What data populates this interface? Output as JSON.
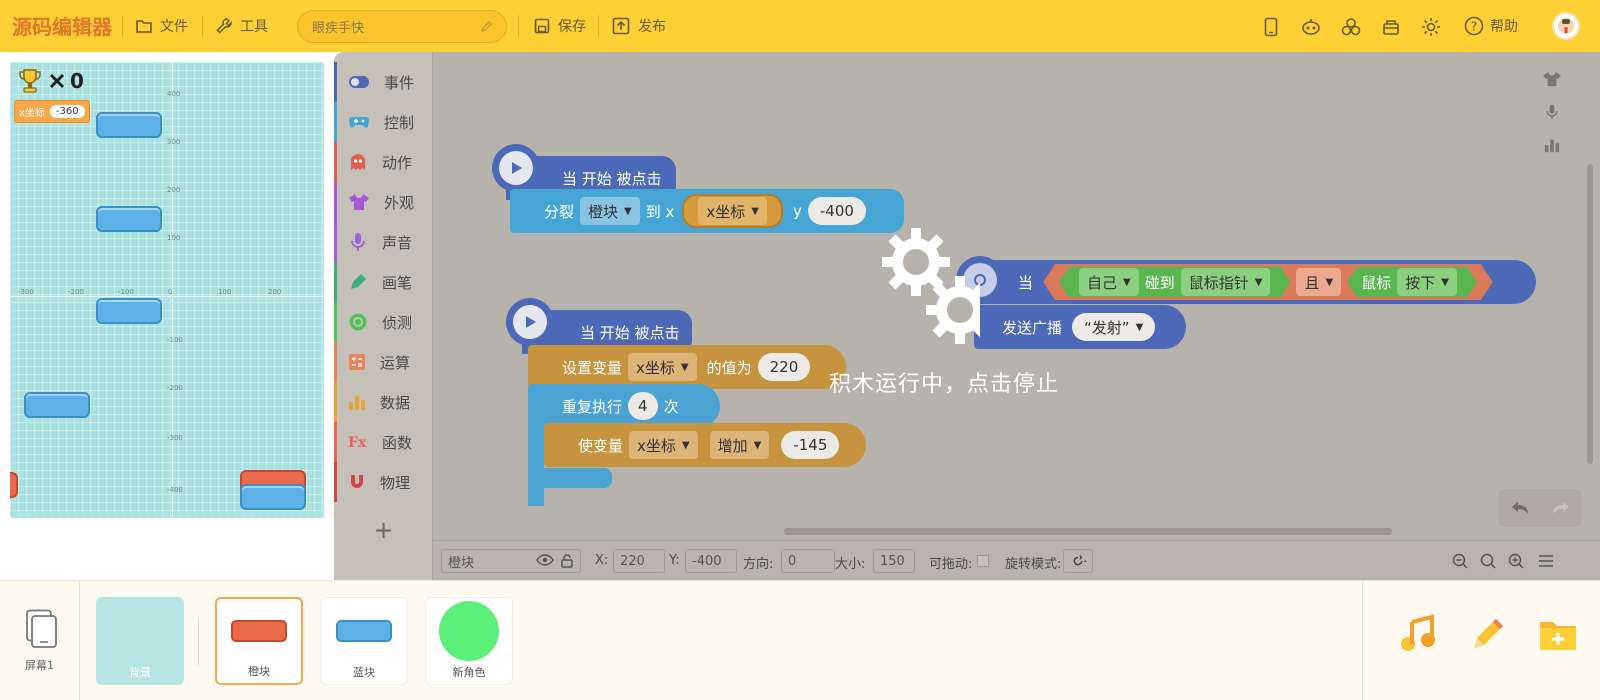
{
  "topbar": {
    "logo": "源码编辑器",
    "file": "文件",
    "tools": "工具",
    "project_name": "眼疾手快",
    "save": "保存",
    "publish": "发布",
    "help": "帮助",
    "bg_color": "#fdd035"
  },
  "stage": {
    "score": "0",
    "var_label": "x坐标",
    "var_value": "-360",
    "ticks_x": [
      "-300",
      "-200",
      "-100",
      "0",
      "100",
      "200"
    ],
    "ticks_y": [
      "400",
      "300",
      "200",
      "100",
      "-100",
      "-200",
      "-300",
      "-400"
    ]
  },
  "palette": [
    {
      "label": "事件",
      "color": "#4d68b7"
    },
    {
      "label": "控制",
      "color": "#45a6d5"
    },
    {
      "label": "动作",
      "color": "#e35e52"
    },
    {
      "label": "外观",
      "color": "#a658d9"
    },
    {
      "label": "声音",
      "color": "#9c63d6"
    },
    {
      "label": "画笔",
      "color": "#3cae73"
    },
    {
      "label": "侦测",
      "color": "#4ec25b"
    },
    {
      "label": "运算",
      "color": "#e6855c"
    },
    {
      "label": "数据",
      "color": "#e8a43c"
    },
    {
      "label": "函数",
      "color": "#ec6060"
    },
    {
      "label": "物理",
      "color": "#d04848"
    }
  ],
  "scripts": {
    "s1_hat": "当 开始 被点击",
    "s1_clone": "分裂",
    "s1_clone_target": "橙块",
    "s1_to_x": "到 x",
    "s1_x_var": "x坐标",
    "s1_y": "y",
    "s1_y_val": "-400",
    "s2_when": "当",
    "s2_self": "自己",
    "s2_touch": "碰到",
    "s2_pointer": "鼠标指针",
    "s2_and": "且",
    "s2_mouse": "鼠标",
    "s2_down": "按下",
    "s2_broadcast": "发送广播",
    "s2_msg": "“发射”",
    "s3_hat": "当 开始 被点击",
    "s3_set": "设置变量",
    "s3_var": "x坐标",
    "s3_value_of": "的值为",
    "s3_value": "220",
    "s3_repeat": "重复执行",
    "s3_times_val": "4",
    "s3_times": "次",
    "s3_change": "使变量",
    "s3_change_var": "x坐标",
    "s3_increase": "增加",
    "s3_delta": "-145",
    "running_overlay": "积木运行中，点击停止"
  },
  "props": {
    "sprite_name": "橙块",
    "x_label": "X:",
    "x": "220",
    "y_label": "Y:",
    "y": "-400",
    "dir_label": "方向:",
    "dir": "0",
    "size_label": "大小:",
    "size": "150",
    "drag_label": "可拖动:",
    "rot_label": "旋转模式:"
  },
  "bottom": {
    "screen_label": "屏幕1",
    "sprites": [
      {
        "label": "背景"
      },
      {
        "label": "橙块"
      },
      {
        "label": "蓝块"
      },
      {
        "label": "新角色"
      }
    ]
  }
}
